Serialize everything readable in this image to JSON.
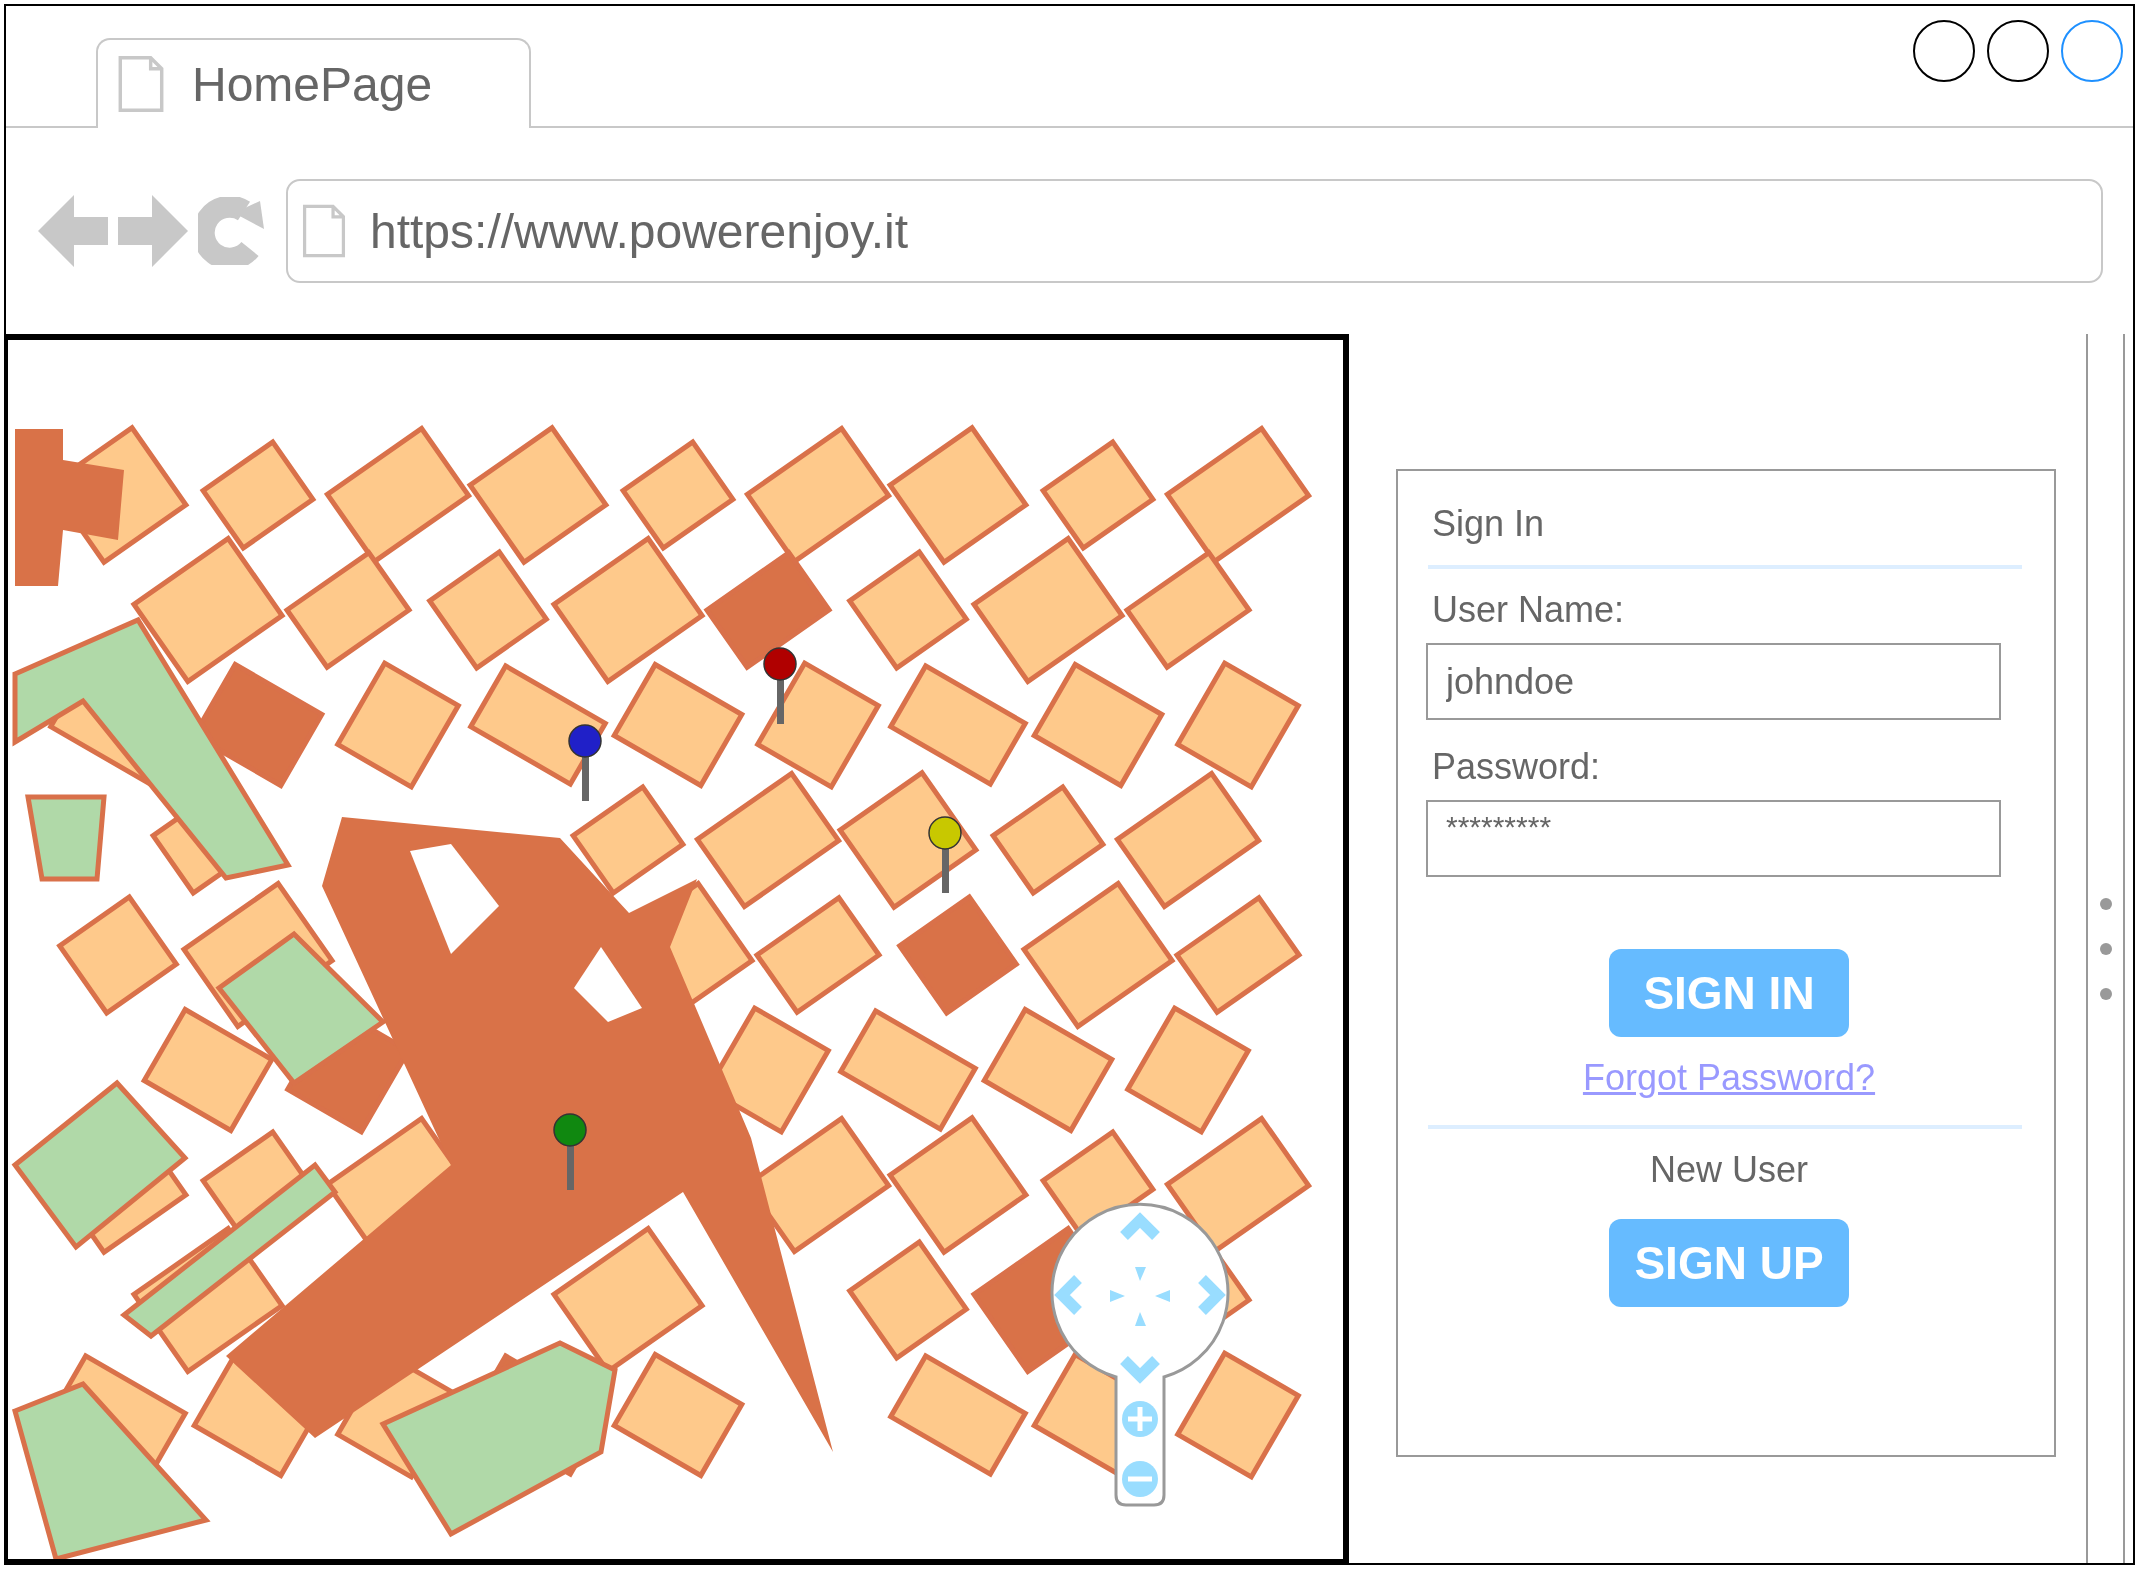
{
  "tab": {
    "title": "HomePage"
  },
  "address_bar": {
    "url": "https://www.powerenjoy.it"
  },
  "map": {
    "pins": [
      {
        "color": "#b00000"
      },
      {
        "color": "#2020c8"
      },
      {
        "color": "#c8c800"
      },
      {
        "color": "#108810"
      }
    ]
  },
  "sign_in": {
    "title": "Sign In",
    "username": {
      "label": "User Name:",
      "value": "johndoe"
    },
    "password": {
      "label": "Password:",
      "value": "*********"
    },
    "sign_in_button": "SIGN IN",
    "forgot_link": "Forgot Password?",
    "new_user": "New User",
    "sign_up_button": "SIGN UP"
  }
}
